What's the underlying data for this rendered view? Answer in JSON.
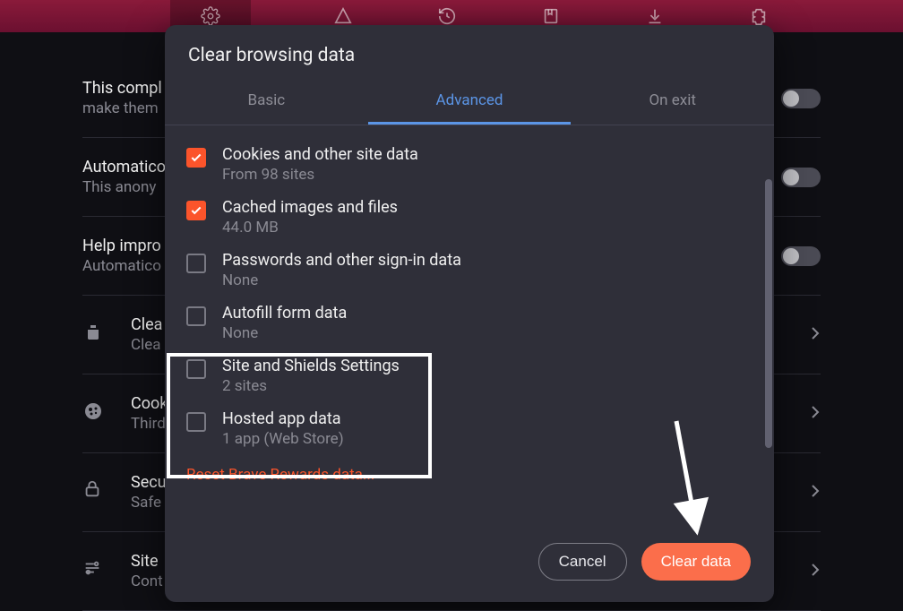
{
  "dialog": {
    "title": "Clear browsing data",
    "tabs": {
      "basic": "Basic",
      "advanced": "Advanced",
      "onexit": "On exit",
      "active": "advanced"
    },
    "items": [
      {
        "checked": true,
        "label": "Cookies and other site data",
        "detail": "From 98 sites"
      },
      {
        "checked": true,
        "label": "Cached images and files",
        "detail": "44.0 MB"
      },
      {
        "checked": false,
        "label": "Passwords and other sign-in data",
        "detail": "None"
      },
      {
        "checked": false,
        "label": "Autofill form data",
        "detail": "None"
      },
      {
        "checked": false,
        "label": "Site and Shields Settings",
        "detail": "2 sites"
      },
      {
        "checked": false,
        "label": "Hosted app data",
        "detail": "1 app (Web Store)"
      }
    ],
    "reset_link": "Reset Brave Rewards data...",
    "cancel": "Cancel",
    "confirm": "Clear data"
  },
  "bg": {
    "row0": {
      "t": "This compl",
      "s": "make them"
    },
    "row1": {
      "t": "Automatico",
      "s": "This anony"
    },
    "row2": {
      "t": "Help impro",
      "s": "Automatico"
    },
    "list": [
      {
        "t": "Clea",
        "s": "Clea"
      },
      {
        "t": "Cook",
        "s": "Third"
      },
      {
        "t": "Secu",
        "s": "Safe"
      },
      {
        "t": "Site",
        "s": "Cont"
      }
    ]
  }
}
